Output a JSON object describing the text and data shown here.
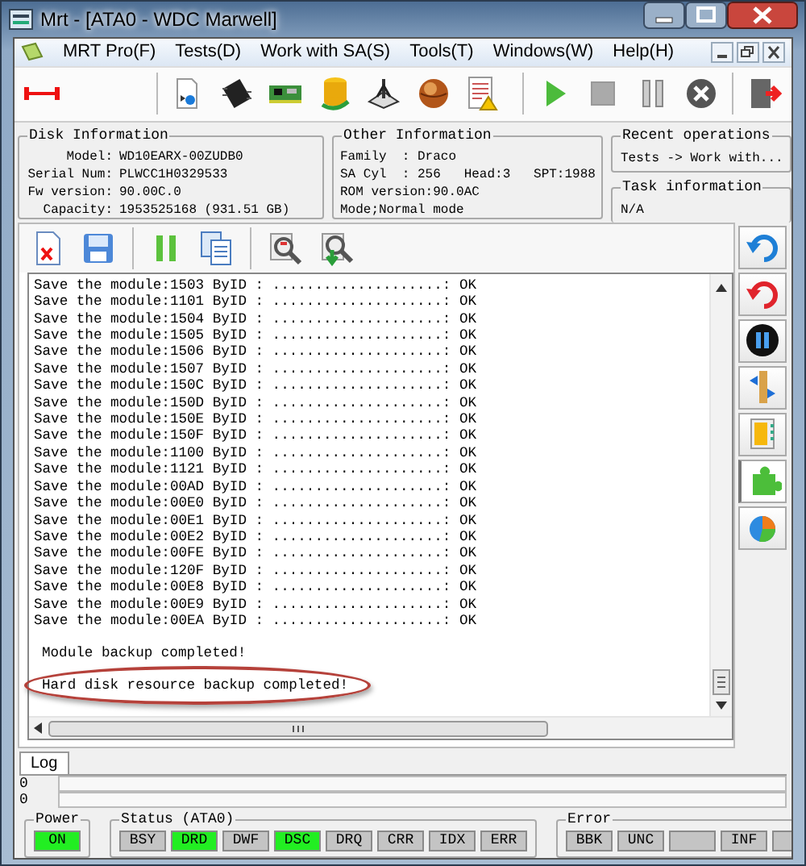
{
  "window": {
    "title": "Mrt - [ATA0 - WDC Marwell]"
  },
  "menu": [
    "MRT Pro(F)",
    "Tests(D)",
    "Work with SA(S)",
    "Tools(T)",
    "Windows(W)",
    "Help(H)"
  ],
  "disk_information": {
    "title": "Disk Information",
    "fields": [
      {
        "label": "Model:",
        "value": "WD10EARX-00ZUDB0"
      },
      {
        "label": "Serial Num:",
        "value": "PLWCC1H0329533"
      },
      {
        "label": "Fw version:",
        "value": "90.00C.0"
      },
      {
        "label": "Capacity:",
        "value": "1953525168 (931.51 GB)"
      }
    ]
  },
  "other_information": {
    "title": "Other Information",
    "lines": [
      "Family  : Draco",
      "SA Cyl  : 256   Head:3   SPT:1988",
      "ROM version:90.0AC",
      "Mode;Normal mode"
    ]
  },
  "recent_operations": {
    "title": "Recent operations",
    "text": "Tests -> Work with..."
  },
  "task_information": {
    "title": "Task information",
    "text": "N/A"
  },
  "log": {
    "lines": [
      "Save the module:1503 ByID : ....................: OK",
      "Save the module:1101 ByID : ....................: OK",
      "Save the module:1504 ByID : ....................: OK",
      "Save the module:1505 ByID : ....................: OK",
      "Save the module:1506 ByID : ....................: OK",
      "Save the module:1507 ByID : ....................: OK",
      "Save the module:150C ByID : ....................: OK",
      "Save the module:150D ByID : ....................: OK",
      "Save the module:150E ByID : ....................: OK",
      "Save the module:150F ByID : ....................: OK",
      "Save the module:1100 ByID : ....................: OK",
      "Save the module:1121 ByID : ....................: OK",
      "Save the module:00AD ByID : ....................: OK",
      "Save the module:00E0 ByID : ....................: OK",
      "Save the module:00E1 ByID : ....................: OK",
      "Save the module:00E2 ByID : ....................: OK",
      "Save the module:00FE ByID : ....................: OK",
      "Save the module:120F ByID : ....................: OK",
      "Save the module:00E8 ByID : ....................: OK",
      "Save the module:00E9 ByID : ....................: OK",
      "Save the module:00EA ByID : ....................: OK"
    ],
    "messages": [
      {
        "text": "Module backup completed!",
        "circled": false
      },
      {
        "text": "Hard disk resource backup completed!",
        "circled": true
      }
    ]
  },
  "tabs": [
    {
      "label": "Log",
      "selected": true
    }
  ],
  "counters": [
    "0",
    "0"
  ],
  "status_groups": [
    {
      "title": "Power",
      "lamps": [
        {
          "label": "ON",
          "on": true
        }
      ]
    },
    {
      "title": "Status (ATA0)",
      "lamps": [
        {
          "label": "BSY",
          "on": false
        },
        {
          "label": "DRD",
          "on": true
        },
        {
          "label": "DWF",
          "on": false
        },
        {
          "label": "DSC",
          "on": true
        },
        {
          "label": "DRQ",
          "on": false
        },
        {
          "label": "CRR",
          "on": false
        },
        {
          "label": "IDX",
          "on": false
        },
        {
          "label": "ERR",
          "on": false
        }
      ]
    },
    {
      "title": "Error",
      "lamps": [
        {
          "label": "BBK",
          "on": false
        },
        {
          "label": "UNC",
          "on": false
        },
        {
          "on": false
        },
        {
          "label": "INF",
          "on": false
        },
        {
          "on": false
        }
      ]
    }
  ]
}
